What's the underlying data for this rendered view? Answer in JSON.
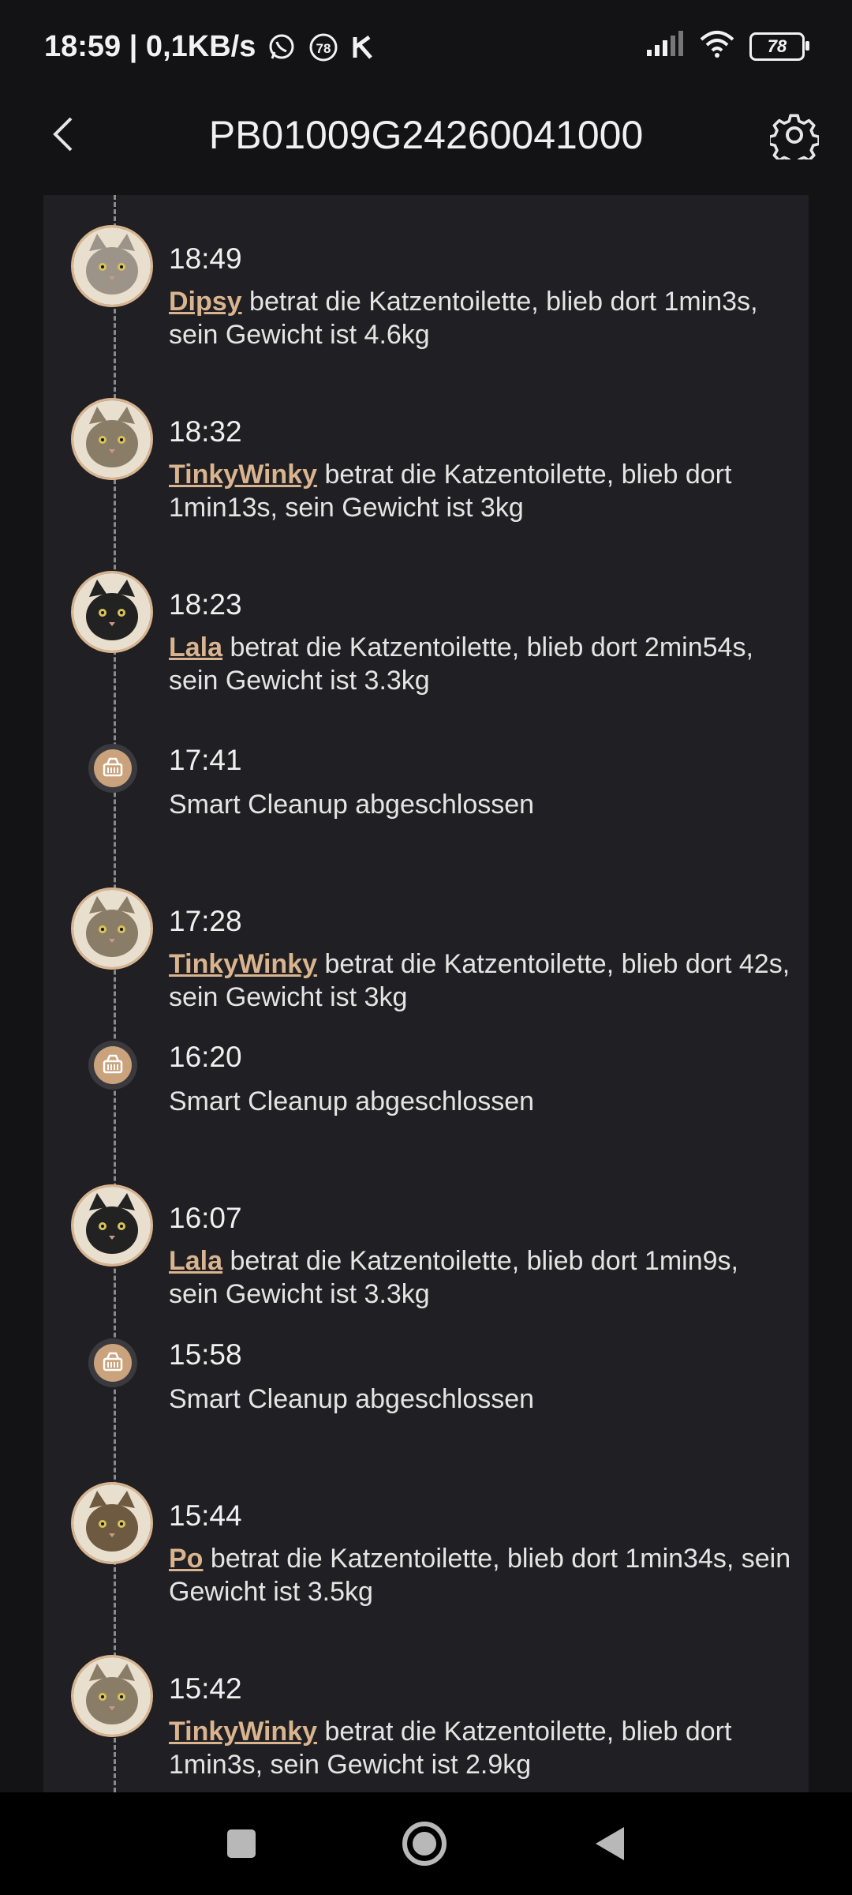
{
  "status_bar": {
    "time_speed": "18:59 | 0,1KB/s",
    "notif_badge": "78",
    "battery": "78"
  },
  "header": {
    "title": "PB01009G24260041000",
    "back_icon": "chevron-left-icon",
    "settings_icon": "gear-icon"
  },
  "colors": {
    "accent": "#d9b48e",
    "panel_bg": "#202024",
    "page_bg": "#131316"
  },
  "entries": [
    {
      "type": "visit",
      "time": "18:49",
      "cat": "Dipsy",
      "text": " betrat die Katzentoilette, blieb dort 1min3s, sein Gewicht ist 4.6kg"
    },
    {
      "type": "visit",
      "time": "18:32",
      "cat": "TinkyWinky",
      "text": " betrat die Katzentoilette, blieb dort 1min13s, sein Gewicht ist 3kg"
    },
    {
      "type": "visit",
      "time": "18:23",
      "cat": "Lala",
      "text": " betrat die Katzentoilette, blieb dort 2min54s, sein Gewicht ist 3.3kg"
    },
    {
      "type": "cleanup",
      "time": "17:41",
      "text": "Smart Cleanup abgeschlossen"
    },
    {
      "type": "visit",
      "time": "17:28",
      "cat": "TinkyWinky",
      "text": " betrat die Katzentoilette, blieb dort 42s, sein Gewicht ist 3kg"
    },
    {
      "type": "cleanup",
      "time": "16:20",
      "text": "Smart Cleanup abgeschlossen"
    },
    {
      "type": "visit",
      "time": "16:07",
      "cat": "Lala",
      "text": " betrat die Katzentoilette, blieb dort 1min9s, sein Gewicht ist 3.3kg"
    },
    {
      "type": "cleanup",
      "time": "15:58",
      "text": "Smart Cleanup abgeschlossen"
    },
    {
      "type": "visit",
      "time": "15:44",
      "cat": "Po",
      "text": " betrat die Katzentoilette, blieb dort 1min34s, sein Gewicht ist 3.5kg"
    },
    {
      "type": "visit",
      "time": "15:42",
      "cat": "TinkyWinky",
      "text": " betrat die Katzentoilette, blieb dort 1min3s, sein Gewicht ist 2.9kg"
    }
  ],
  "nav": {
    "recents_icon": "square-icon",
    "home_icon": "circle-icon",
    "back_icon": "triangle-back-icon"
  }
}
